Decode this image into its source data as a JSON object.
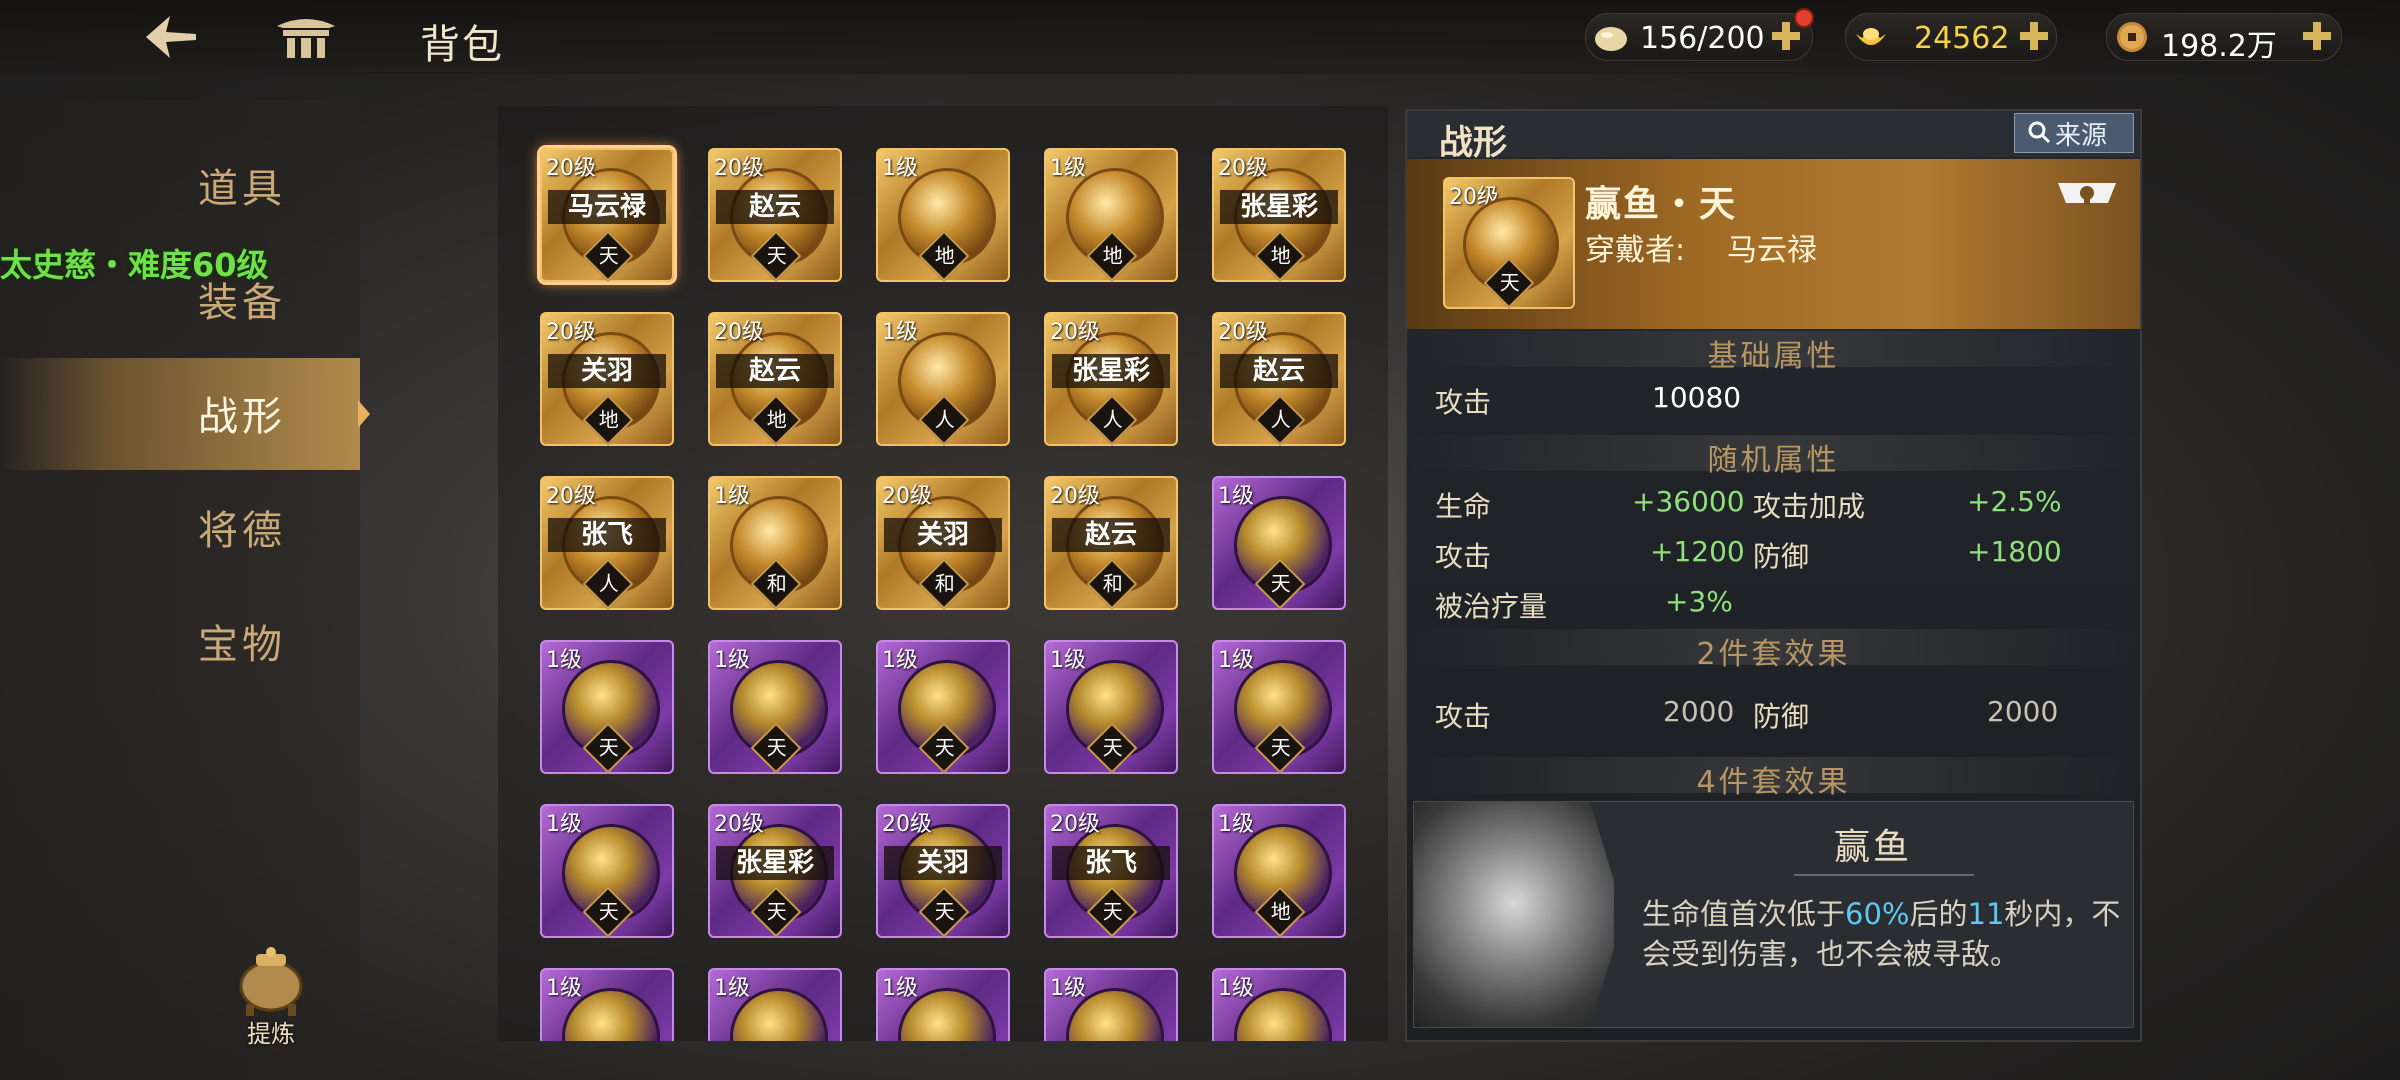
{
  "header": {
    "title": "背包",
    "back_icon": "back-arrow-icon",
    "home_icon": "palace-gate-icon"
  },
  "currencies": [
    {
      "icon": "rice-ball-icon",
      "value": "156/200",
      "has_alert": true,
      "color": "#ffffff"
    },
    {
      "icon": "gold-ingot-icon",
      "value": "24562",
      "color": "#f7d04a"
    },
    {
      "icon": "copper-coin-icon",
      "value": "198.2万",
      "color": "#ffffff"
    }
  ],
  "sidebar": {
    "items": [
      {
        "label": "道具",
        "active": false
      },
      {
        "label": "装备",
        "active": false
      },
      {
        "label": "战形",
        "active": true
      },
      {
        "label": "将德",
        "active": false
      },
      {
        "label": "宝物",
        "active": false
      }
    ],
    "refine_label": "提炼",
    "quest_tip": "太史慈・难度60级"
  },
  "grid": [
    {
      "level": "20级",
      "name": "马云禄",
      "tier": "天",
      "rarity": "gold",
      "selected": true
    },
    {
      "level": "20级",
      "name": "赵云",
      "tier": "天",
      "rarity": "gold"
    },
    {
      "level": "1级",
      "name": "",
      "tier": "地",
      "rarity": "gold"
    },
    {
      "level": "1级",
      "name": "",
      "tier": "地",
      "rarity": "gold"
    },
    {
      "level": "20级",
      "name": "张星彩",
      "tier": "地",
      "rarity": "gold"
    },
    {
      "level": "20级",
      "name": "关羽",
      "tier": "地",
      "rarity": "gold"
    },
    {
      "level": "20级",
      "name": "赵云",
      "tier": "地",
      "rarity": "gold"
    },
    {
      "level": "1级",
      "name": "",
      "tier": "人",
      "rarity": "gold"
    },
    {
      "level": "20级",
      "name": "张星彩",
      "tier": "人",
      "rarity": "gold"
    },
    {
      "level": "20级",
      "name": "赵云",
      "tier": "人",
      "rarity": "gold"
    },
    {
      "level": "20级",
      "name": "张飞",
      "tier": "人",
      "rarity": "gold"
    },
    {
      "level": "1级",
      "name": "",
      "tier": "和",
      "rarity": "gold"
    },
    {
      "level": "20级",
      "name": "关羽",
      "tier": "和",
      "rarity": "gold"
    },
    {
      "level": "20级",
      "name": "赵云",
      "tier": "和",
      "rarity": "gold"
    },
    {
      "level": "1级",
      "name": "",
      "tier": "天",
      "rarity": "purple"
    },
    {
      "level": "1级",
      "name": "",
      "tier": "天",
      "rarity": "purple"
    },
    {
      "level": "1级",
      "name": "",
      "tier": "天",
      "rarity": "purple"
    },
    {
      "level": "1级",
      "name": "",
      "tier": "天",
      "rarity": "purple"
    },
    {
      "level": "1级",
      "name": "",
      "tier": "天",
      "rarity": "purple"
    },
    {
      "level": "1级",
      "name": "",
      "tier": "天",
      "rarity": "purple"
    },
    {
      "level": "1级",
      "name": "",
      "tier": "天",
      "rarity": "purple"
    },
    {
      "level": "20级",
      "name": "张星彩",
      "tier": "天",
      "rarity": "purple"
    },
    {
      "level": "20级",
      "name": "关羽",
      "tier": "天",
      "rarity": "purple"
    },
    {
      "level": "20级",
      "name": "张飞",
      "tier": "天",
      "rarity": "purple"
    },
    {
      "level": "1级",
      "name": "",
      "tier": "地",
      "rarity": "purple"
    },
    {
      "level": "1级",
      "name": "",
      "tier": "",
      "rarity": "purple"
    },
    {
      "level": "1级",
      "name": "",
      "tier": "",
      "rarity": "purple"
    },
    {
      "level": "1级",
      "name": "",
      "tier": "",
      "rarity": "purple"
    },
    {
      "level": "1级",
      "name": "",
      "tier": "",
      "rarity": "purple"
    },
    {
      "level": "1级",
      "name": "",
      "tier": "",
      "rarity": "purple"
    }
  ],
  "detail": {
    "title": "战形",
    "source_label": "来源",
    "hero": {
      "level": "20级",
      "tier": "天",
      "name": "赢鱼・天",
      "wearer_label": "穿戴者:",
      "wearer": "马云禄"
    },
    "base_header": "基础属性",
    "base": [
      {
        "label": "攻击",
        "value": "10080"
      }
    ],
    "random_header": "随机属性",
    "random": [
      {
        "label": "生命",
        "value": "+36000"
      },
      {
        "label": "攻击加成",
        "value": "+2.5%"
      },
      {
        "label": "攻击",
        "value": "+1200"
      },
      {
        "label": "防御",
        "value": "+1800"
      },
      {
        "label": "被治疗量",
        "value": "+3%"
      }
    ],
    "set2_header": "2件套效果",
    "set2": [
      {
        "label": "攻击",
        "value": "2000"
      },
      {
        "label": "防御",
        "value": "2000"
      }
    ],
    "set4_header": "4件套效果",
    "set4": {
      "name": "赢鱼",
      "desc_a": "生命值首次低于",
      "desc_pct": "60%",
      "desc_b": "后的",
      "desc_sec": "11",
      "desc_c": "秒内，不会受到伤害，也不会被寻敌。"
    }
  }
}
